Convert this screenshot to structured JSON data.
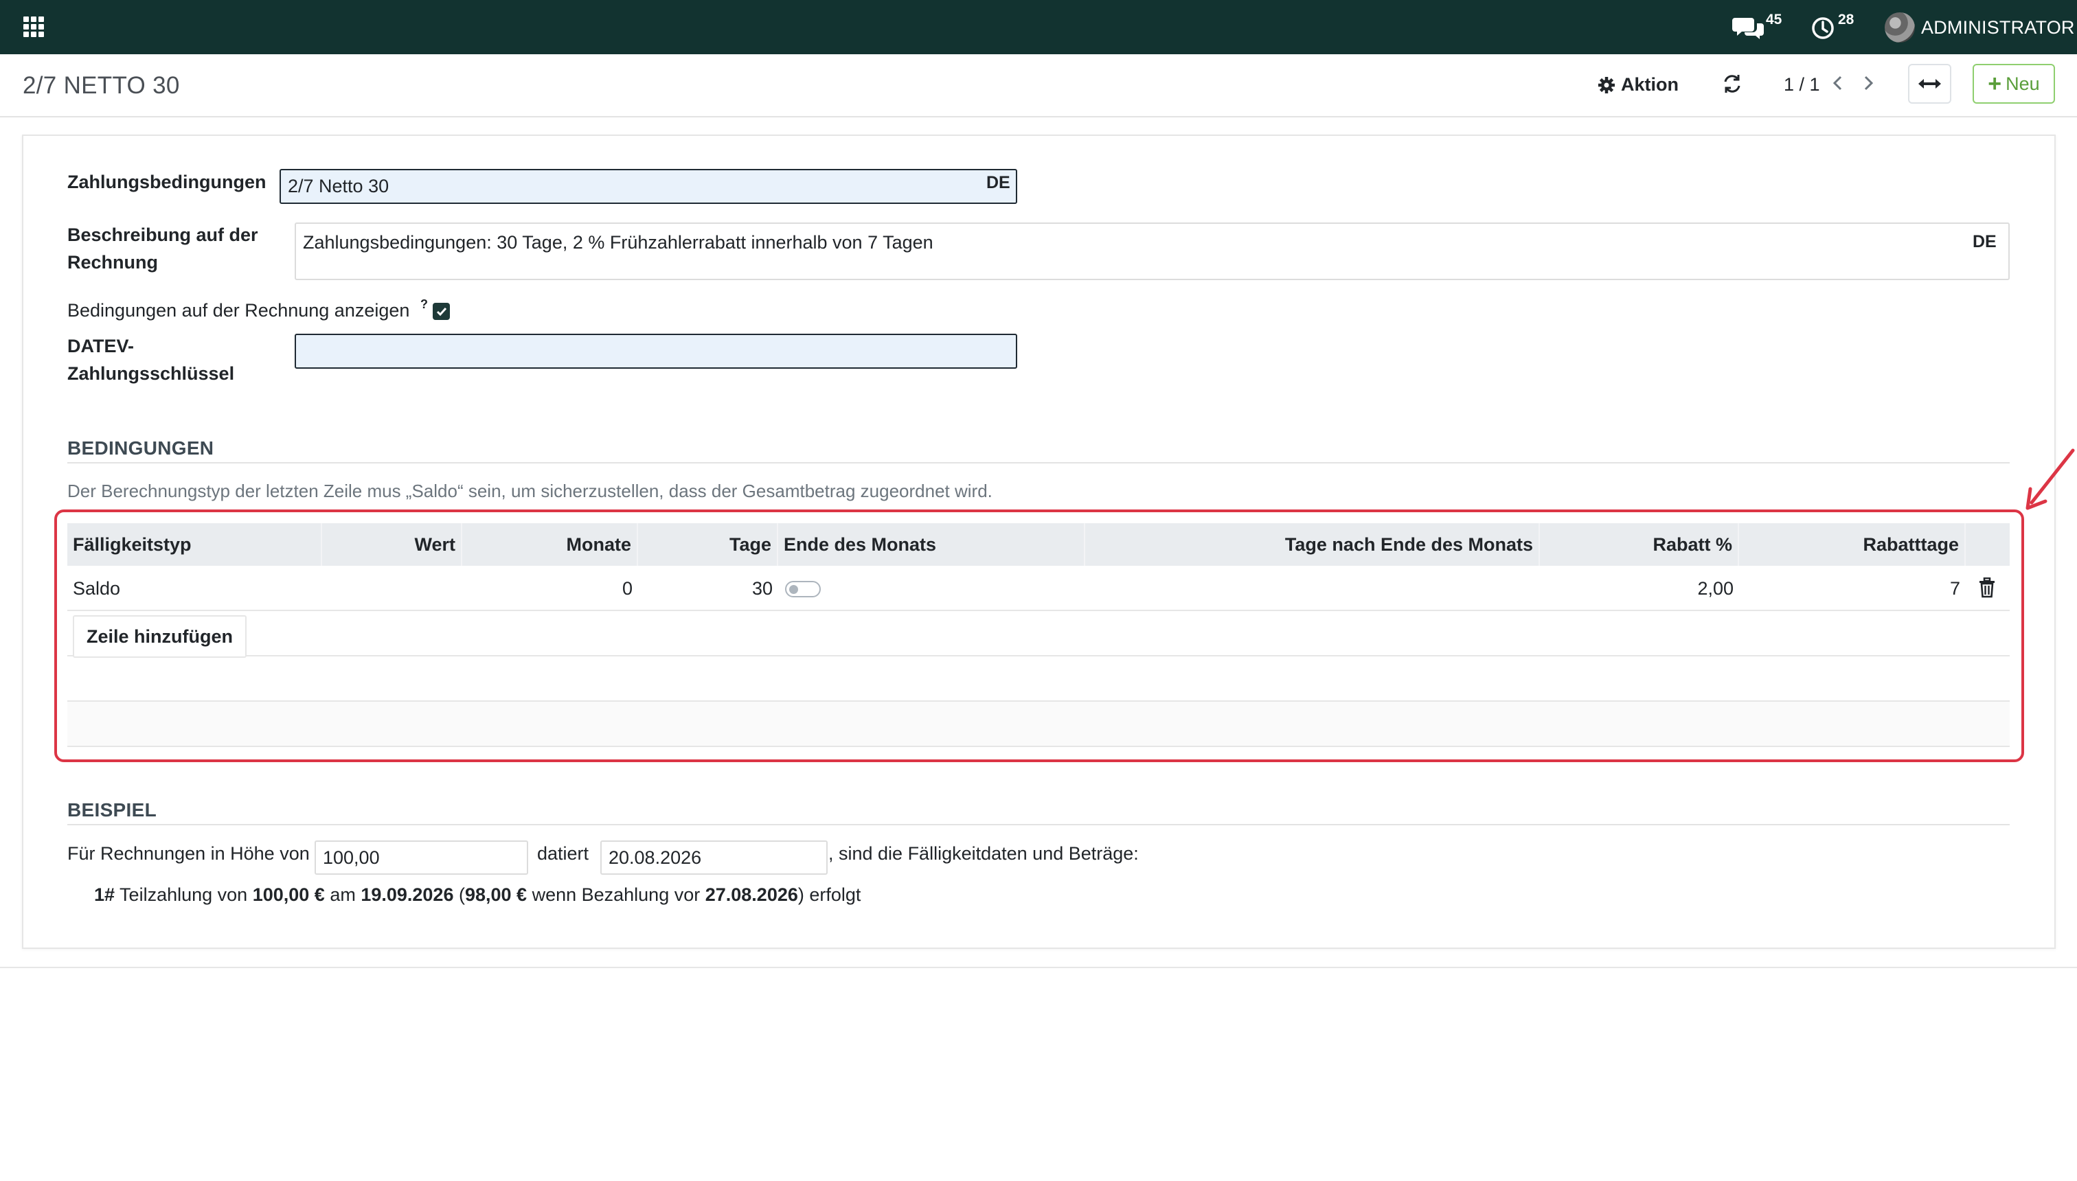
{
  "topbar": {
    "messages_count": "45",
    "activities_count": "28",
    "user_name": "ADMINISTRATOR"
  },
  "control": {
    "title": "2/7 NETTO 30",
    "action_label": "Aktion",
    "pager_text": "1 / 1",
    "new_label": "Neu"
  },
  "form": {
    "payment_terms_label": "Zahlungsbedingungen",
    "payment_terms_value": "2/7 Netto 30",
    "lang_code": "DE",
    "description_label_1": "Beschreibung auf der",
    "description_label_2": "Rechnung",
    "description_value": "Zahlungsbedingungen: 30 Tage, 2 % Frühzahlerrabatt innerhalb von 7 Tagen",
    "show_on_invoice_label": "Bedingungen auf der Rechnung anzeigen",
    "help_mark": "?",
    "datev_label_1": "DATEV-",
    "datev_label_2": "Zahlungsschlüssel",
    "datev_value": ""
  },
  "terms": {
    "section_title": "BEDINGUNGEN",
    "hint": "Der Berechnungstyp der letzten Zeile mus „Saldo“ sein, um sicherzustellen, dass der Gesamtbetrag zugeordnet wird.",
    "columns": {
      "due_type": "Fälligkeitstyp",
      "value": "Wert",
      "months": "Monate",
      "days": "Tage",
      "end_of_month": "Ende des Monats",
      "days_after_eom": "Tage nach Ende des Monats",
      "discount_pct": "Rabatt %",
      "discount_days": "Rabatttage"
    },
    "rows": [
      {
        "due_type": "Saldo",
        "value": "",
        "months": "0",
        "days": "30",
        "end_of_month": false,
        "days_after_eom": "",
        "discount_pct": "2,00",
        "discount_days": "7"
      }
    ],
    "add_line_label": "Zeile hinzufügen"
  },
  "example": {
    "section_title": "BEISPIEL",
    "prefix": "Für Rechnungen in Höhe von",
    "amount": "100,00",
    "dated_label": "datiert",
    "date": "20.08.2026",
    "suffix": ", sind die Fälligkeitdaten und Beträge:",
    "line_index": "1#",
    "line_t1": " Teilzahlung von ",
    "line_amount": "100,00 €",
    "line_t2": " am ",
    "line_due": "19.09.2026",
    "line_t3": " (",
    "line_discounted": "98,00 €",
    "line_t4": " wenn Bezahlung vor ",
    "line_discount_date": "27.08.2026",
    "line_t5": ") erfolgt"
  }
}
